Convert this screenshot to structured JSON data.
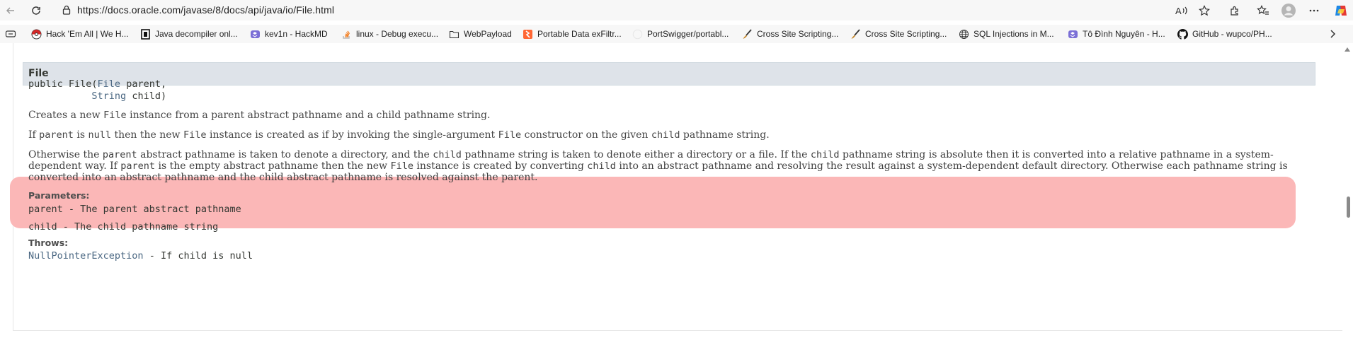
{
  "browser": {
    "url": "https://docs.oracle.com/javase/8/docs/api/java/io/File.html"
  },
  "bookmarks": [
    {
      "label": "Hack 'Em All | We H...",
      "icon": "pokeball-icon"
    },
    {
      "label": "Java decompiler onl...",
      "icon": "java-decompiler-icon"
    },
    {
      "label": "kev1n - HackMD",
      "icon": "hackmd-icon"
    },
    {
      "label": "linux - Debug execu...",
      "icon": "stackoverflow-icon"
    },
    {
      "label": "WebPayload",
      "icon": "folder-icon"
    },
    {
      "label": "Portable Data exFiltr...",
      "icon": "portswigger-icon"
    },
    {
      "label": "PortSwigger/portabl...",
      "icon": "github-icon"
    },
    {
      "label": "Cross Site Scripting...",
      "icon": "brush-icon"
    },
    {
      "label": "Cross Site Scripting...",
      "icon": "brush-icon"
    },
    {
      "label": "SQL Injections in M...",
      "icon": "globe-icon"
    },
    {
      "label": "Tô Đình Nguyên - H...",
      "icon": "hackmd-icon"
    },
    {
      "label": "GitHub - wupco/PH...",
      "icon": "github-icon"
    }
  ],
  "doc": {
    "heading": "File",
    "sig_line1_a": "public File(",
    "sig_type1": "File",
    "sig_line1_b": " parent,",
    "sig_type2": "String",
    "sig_line2_b": " child)",
    "p1": [
      "Creates a new ",
      "File",
      " instance from a parent abstract pathname and a child pathname string."
    ],
    "p2": [
      "If ",
      "parent",
      " is ",
      "null",
      " then the new ",
      "File",
      " instance is created as if by invoking the single-argument ",
      "File",
      " constructor on the given ",
      "child",
      " pathname string."
    ],
    "p3_line1": [
      "Otherwise the ",
      "parent",
      " abstract pathname is taken to denote a directory, and the ",
      "child",
      " pathname string is taken to denote either a directory or a file. If the ",
      "child",
      " pathname string is absolute then it is converted into a relative pathname in a system-"
    ],
    "p3_line2": [
      "dependent way. If ",
      "parent",
      " is the empty abstract pathname then the new ",
      "File",
      " instance is created by converting ",
      "child",
      " into an abstract pathname and resolving the result against a system-dependent default directory. Otherwise each pathname string is"
    ],
    "p3_line3": "converted into an abstract pathname and the child abstract pathname is resolved against the parent.",
    "parameters_label": "Parameters:",
    "param1": "parent - The parent abstract pathname",
    "param2": "child - The child pathname string",
    "throws_label": "Throws:",
    "throws_link": "NullPointerException",
    "throws_text": " - If child is null"
  },
  "colors": {
    "highlight": "#fbb7b7",
    "heading_bg": "#dee3e9",
    "link": "#4a6782"
  }
}
